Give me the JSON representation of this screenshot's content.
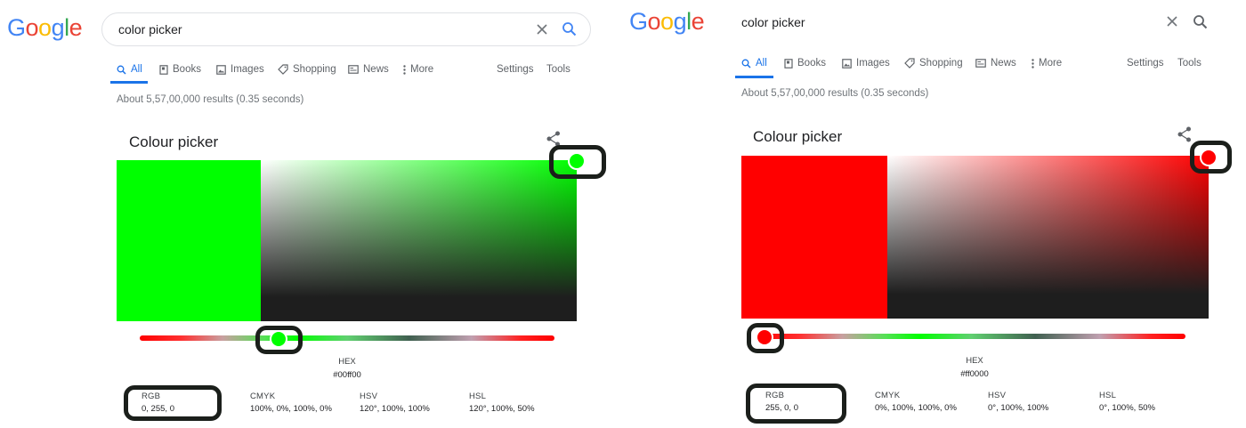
{
  "logo_text": [
    "G",
    "o",
    "o",
    "g",
    "l",
    "e"
  ],
  "logo_colors": [
    "#4285f4",
    "#ea4335",
    "#fbbc05",
    "#4285f4",
    "#34a853",
    "#ea4335"
  ],
  "search": {
    "query": "color picker"
  },
  "tabs": [
    {
      "label": "All",
      "icon": "search-icon"
    },
    {
      "label": "Books",
      "icon": "book-icon"
    },
    {
      "label": "Images",
      "icon": "image-icon"
    },
    {
      "label": "Shopping",
      "icon": "tag-icon"
    },
    {
      "label": "News",
      "icon": "news-icon"
    },
    {
      "label": "More",
      "icon": "more-vert-icon"
    }
  ],
  "settings_label": "Settings",
  "tools_label": "Tools",
  "results_stats": "About 5,57,00,000 results (0.35 seconds)",
  "widget": {
    "title": "Colour picker",
    "hex_label": "HEX",
    "rgb_label": "RGB",
    "cmyk_label": "CMYK",
    "hsv_label": "HSV",
    "hsl_label": "HSL"
  },
  "left": {
    "hex": "#00ff00",
    "rgb": "0, 255, 0",
    "cmyk": "100%, 0%, 100%, 0%",
    "hsv": "120°, 100%, 100%",
    "hsl": "120°, 100%, 50%",
    "swatch_color": "#00ff00",
    "hue_position": 0.33
  },
  "right": {
    "hex": "#ff0000",
    "rgb": "255, 0, 0",
    "cmyk": "0%, 100%, 100%, 0%",
    "hsv": "0°, 100%, 100%",
    "hsl": "0°, 100%, 50%",
    "swatch_color": "#ff0000",
    "hue_position": 0.0
  },
  "highlight_color": "#1b1f1b"
}
